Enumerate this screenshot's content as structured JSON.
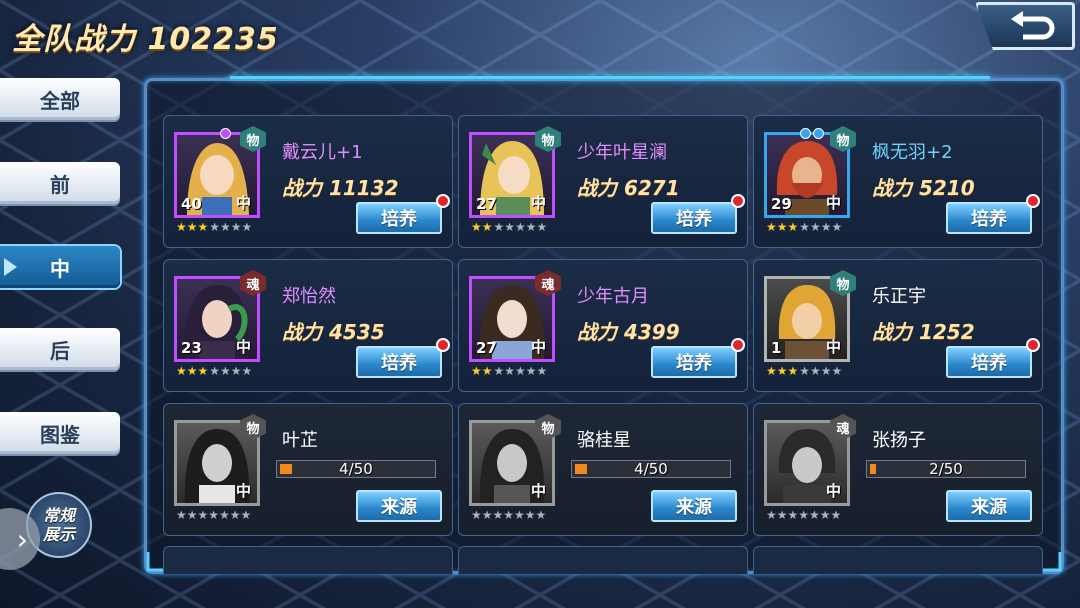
{
  "header": {
    "title": "全队战力 102235"
  },
  "sidebar": {
    "tabs": [
      {
        "label": "全部"
      },
      {
        "label": "前"
      },
      {
        "label": "中"
      },
      {
        "label": "后"
      },
      {
        "label": "图鉴"
      }
    ],
    "active_tab": "中",
    "mode_badge": {
      "line1": "常规",
      "line2": "展示"
    }
  },
  "colors": {
    "accent": "#4ed4ff",
    "rare_purple": "#c04dff",
    "rare_blue": "#33a7f0",
    "progress_fill": "#f08a1e",
    "power_text": "#ffe3a8"
  },
  "icons": {
    "back": "back-arrow-icon",
    "expand": "chevron-right-icon",
    "alert": "red-dot-icon"
  },
  "cards": [
    {
      "name": "戴云儿+1",
      "power_label": "战力 11132",
      "level": "40",
      "position": "中",
      "type": "物",
      "stars": 3,
      "gems": 1,
      "button": "培养",
      "owned": true,
      "quality": "purple"
    },
    {
      "name": "少年叶星澜",
      "power_label": "战力 6271",
      "level": "27",
      "position": "中",
      "type": "物",
      "stars": 2,
      "gems": 0,
      "button": "培养",
      "owned": true,
      "quality": "purple"
    },
    {
      "name": "枫无羽+2",
      "power_label": "战力 5210",
      "level": "29",
      "position": "中",
      "type": "物",
      "stars": 3,
      "gems": 2,
      "button": "培养",
      "owned": true,
      "quality": "blue"
    },
    {
      "name": "郑怡然",
      "power_label": "战力 4535",
      "level": "23",
      "position": "中",
      "type": "魂",
      "stars": 3,
      "gems": 0,
      "button": "培养",
      "owned": true,
      "quality": "purple"
    },
    {
      "name": "少年古月",
      "power_label": "战力 4399",
      "level": "27",
      "position": "中",
      "type": "魂",
      "stars": 2,
      "gems": 0,
      "button": "培养",
      "owned": true,
      "quality": "purple"
    },
    {
      "name": "乐正宇",
      "power_label": "战力 1252",
      "level": "1",
      "position": "中",
      "type": "物",
      "stars": 3,
      "gems": 0,
      "button": "培养",
      "owned": true,
      "quality": "gray"
    },
    {
      "name": "叶芷",
      "progress_text": "4/50",
      "progress": 0.08,
      "position": "中",
      "type": "物",
      "stars": 0,
      "button": "来源",
      "owned": false
    },
    {
      "name": "骆桂星",
      "progress_text": "4/50",
      "progress": 0.08,
      "position": "中",
      "type": "物",
      "stars": 0,
      "button": "来源",
      "owned": false
    },
    {
      "name": "张扬子",
      "progress_text": "2/50",
      "progress": 0.04,
      "position": "中",
      "type": "魂",
      "stars": 0,
      "button": "来源",
      "owned": false
    }
  ]
}
